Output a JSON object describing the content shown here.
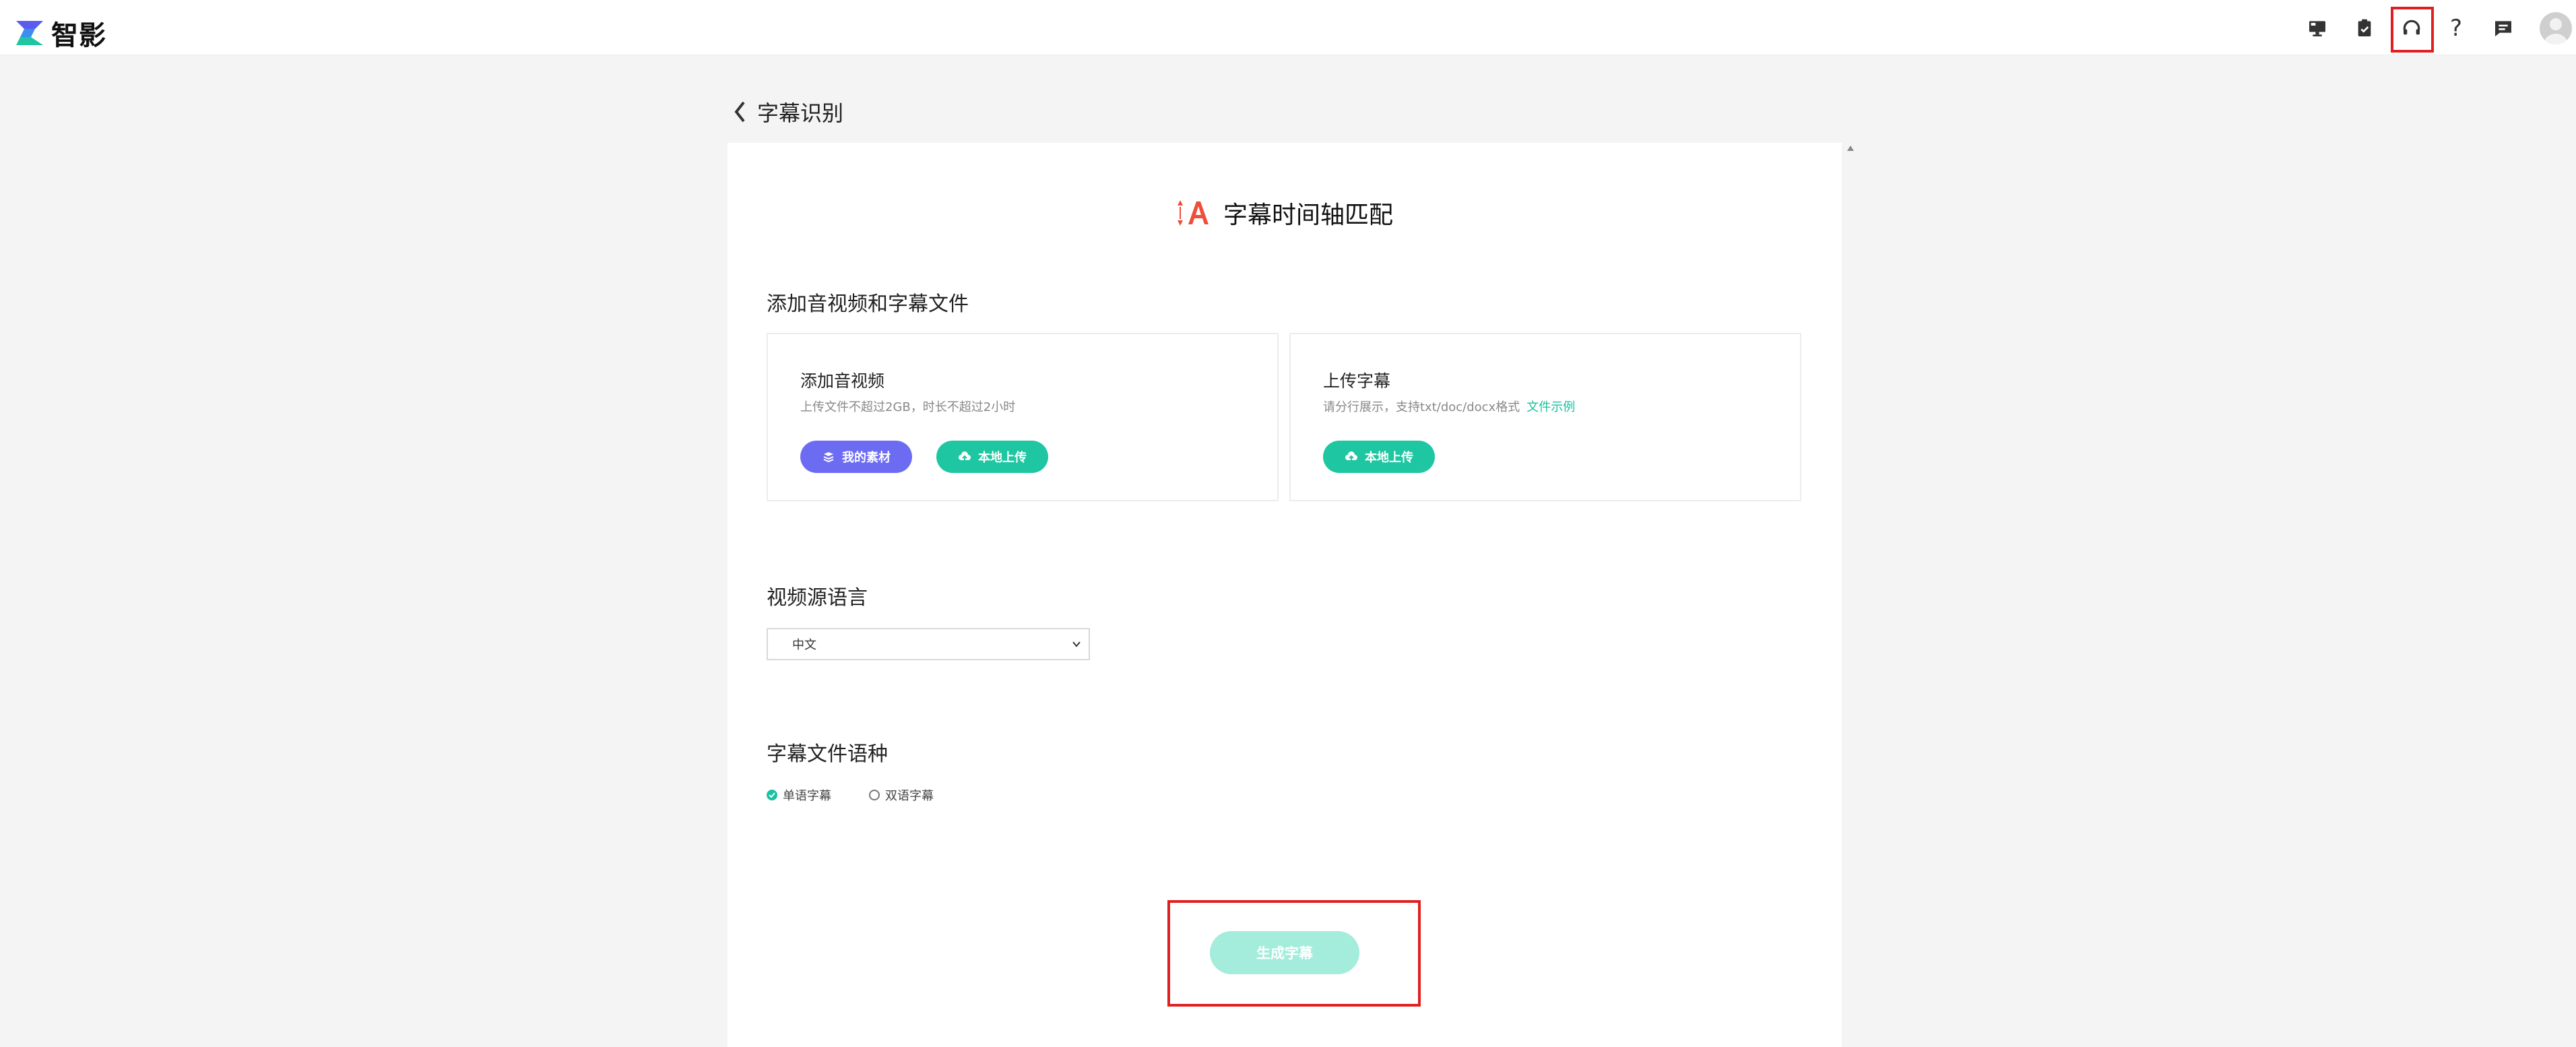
{
  "app": {
    "name": "智影"
  },
  "header": {
    "icons": [
      "monitor-icon",
      "clipboard-check-icon",
      "headset-icon",
      "help-icon",
      "message-icon"
    ],
    "help_glyph": "?"
  },
  "page": {
    "back_label": "字幕识别",
    "title": "字幕时间轴匹配"
  },
  "upload_section": {
    "heading": "添加音视频和字幕文件",
    "media_box": {
      "title": "添加音视频",
      "desc": "上传文件不超过2GB，时长不超过2小时",
      "my_assets_label": "我的素材",
      "local_upload_label": "本地上传"
    },
    "subtitle_box": {
      "title": "上传字幕",
      "desc": "请分行展示，支持txt/doc/docx格式",
      "example_link": "文件示例",
      "local_upload_label": "本地上传"
    }
  },
  "language_section": {
    "heading": "视频源语言",
    "selected": "中文"
  },
  "subtitle_lang_section": {
    "heading": "字幕文件语种",
    "options": [
      {
        "label": "单语字幕",
        "checked": true
      },
      {
        "label": "双语字幕",
        "checked": false
      }
    ]
  },
  "generate_button": "生成字幕",
  "colors": {
    "accent": "#1ec6a1",
    "purple": "#6c6cf3",
    "highlight": "#e02020",
    "title_icon": "#f04d3a"
  }
}
